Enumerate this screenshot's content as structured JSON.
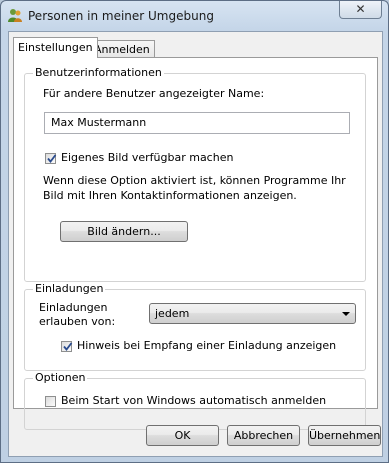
{
  "window": {
    "title": "Personen in meiner Umgebung",
    "close_glyph": "✕"
  },
  "tabs": [
    {
      "label": "Einstellungen",
      "active": true
    },
    {
      "label": "Anmelden",
      "active": false
    }
  ],
  "user_info": {
    "group_title": "Benutzerinformationen",
    "name_label": "Für andere Benutzer angezeigter Name:",
    "name_value": "Max Mustermann",
    "share_picture_checkbox": {
      "label": "Eigenes Bild verfügbar machen",
      "checked": true
    },
    "description_line1": "Wenn diese Option aktiviert ist, können Programme Ihr",
    "description_line2": "Bild mit Ihren Kontaktinformationen anzeigen.",
    "change_picture_button": "Bild ändern..."
  },
  "invitations": {
    "group_title": "Einladungen",
    "allow_label_line1": "Einladungen",
    "allow_label_line2": "erlauben von:",
    "allow_select_value": "jedem",
    "notify_checkbox": {
      "label": "Hinweis bei Empfang einer Einladung anzeigen",
      "checked": true
    }
  },
  "options": {
    "group_title": "Optionen",
    "autostart_checkbox": {
      "label": "Beim Start von Windows automatisch anmelden",
      "checked": false
    }
  },
  "footer": {
    "ok": "OK",
    "cancel": "Abbrechen",
    "apply": "Übernehmen"
  },
  "colors": {
    "check_mark": "#2a4b8d",
    "title_text": "#1b1b1b"
  }
}
